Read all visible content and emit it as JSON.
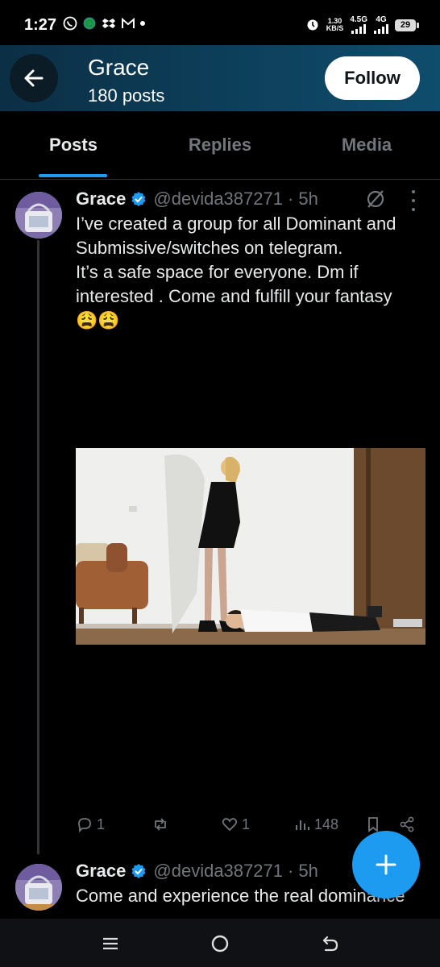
{
  "status_bar": {
    "time": "1:27",
    "left_icons": [
      "whatsapp-icon",
      "whatsapp-business-icon",
      "dropbox-icon",
      "gmail-icon"
    ],
    "speed_value": "1.30",
    "speed_unit": "KB/S",
    "network_1": "4.5G",
    "network_2": "4G",
    "battery": "29"
  },
  "header": {
    "name": "Grace",
    "posts_count": "180 posts",
    "follow_label": "Follow",
    "gradient_start": "#0b2f45",
    "gradient_end": "#0f4d6d"
  },
  "tabs": [
    {
      "label": "Posts",
      "active": true
    },
    {
      "label": "Replies",
      "active": false
    },
    {
      "label": "Media",
      "active": false
    }
  ],
  "tweets": [
    {
      "name": "Grace",
      "handle": "@devida387271",
      "time": "· 5h",
      "lines": [
        "I’ve created a group for all Dominant and",
        "Submissive/switches on telegram.",
        "It’s a safe space for everyone. Dm if",
        "interested . Come and fulfill your fantasy",
        "😩😩"
      ],
      "replies": "1",
      "reposts": "",
      "likes": "1",
      "views": "148"
    },
    {
      "name": "Grace",
      "handle": "@devida387271",
      "time": "· 5h",
      "text": "Come and experience the real dominance"
    }
  ],
  "colors": {
    "accent": "#1d9bf0",
    "muted": "#71767b",
    "text": "#e7e9ea",
    "background": "#000000"
  }
}
